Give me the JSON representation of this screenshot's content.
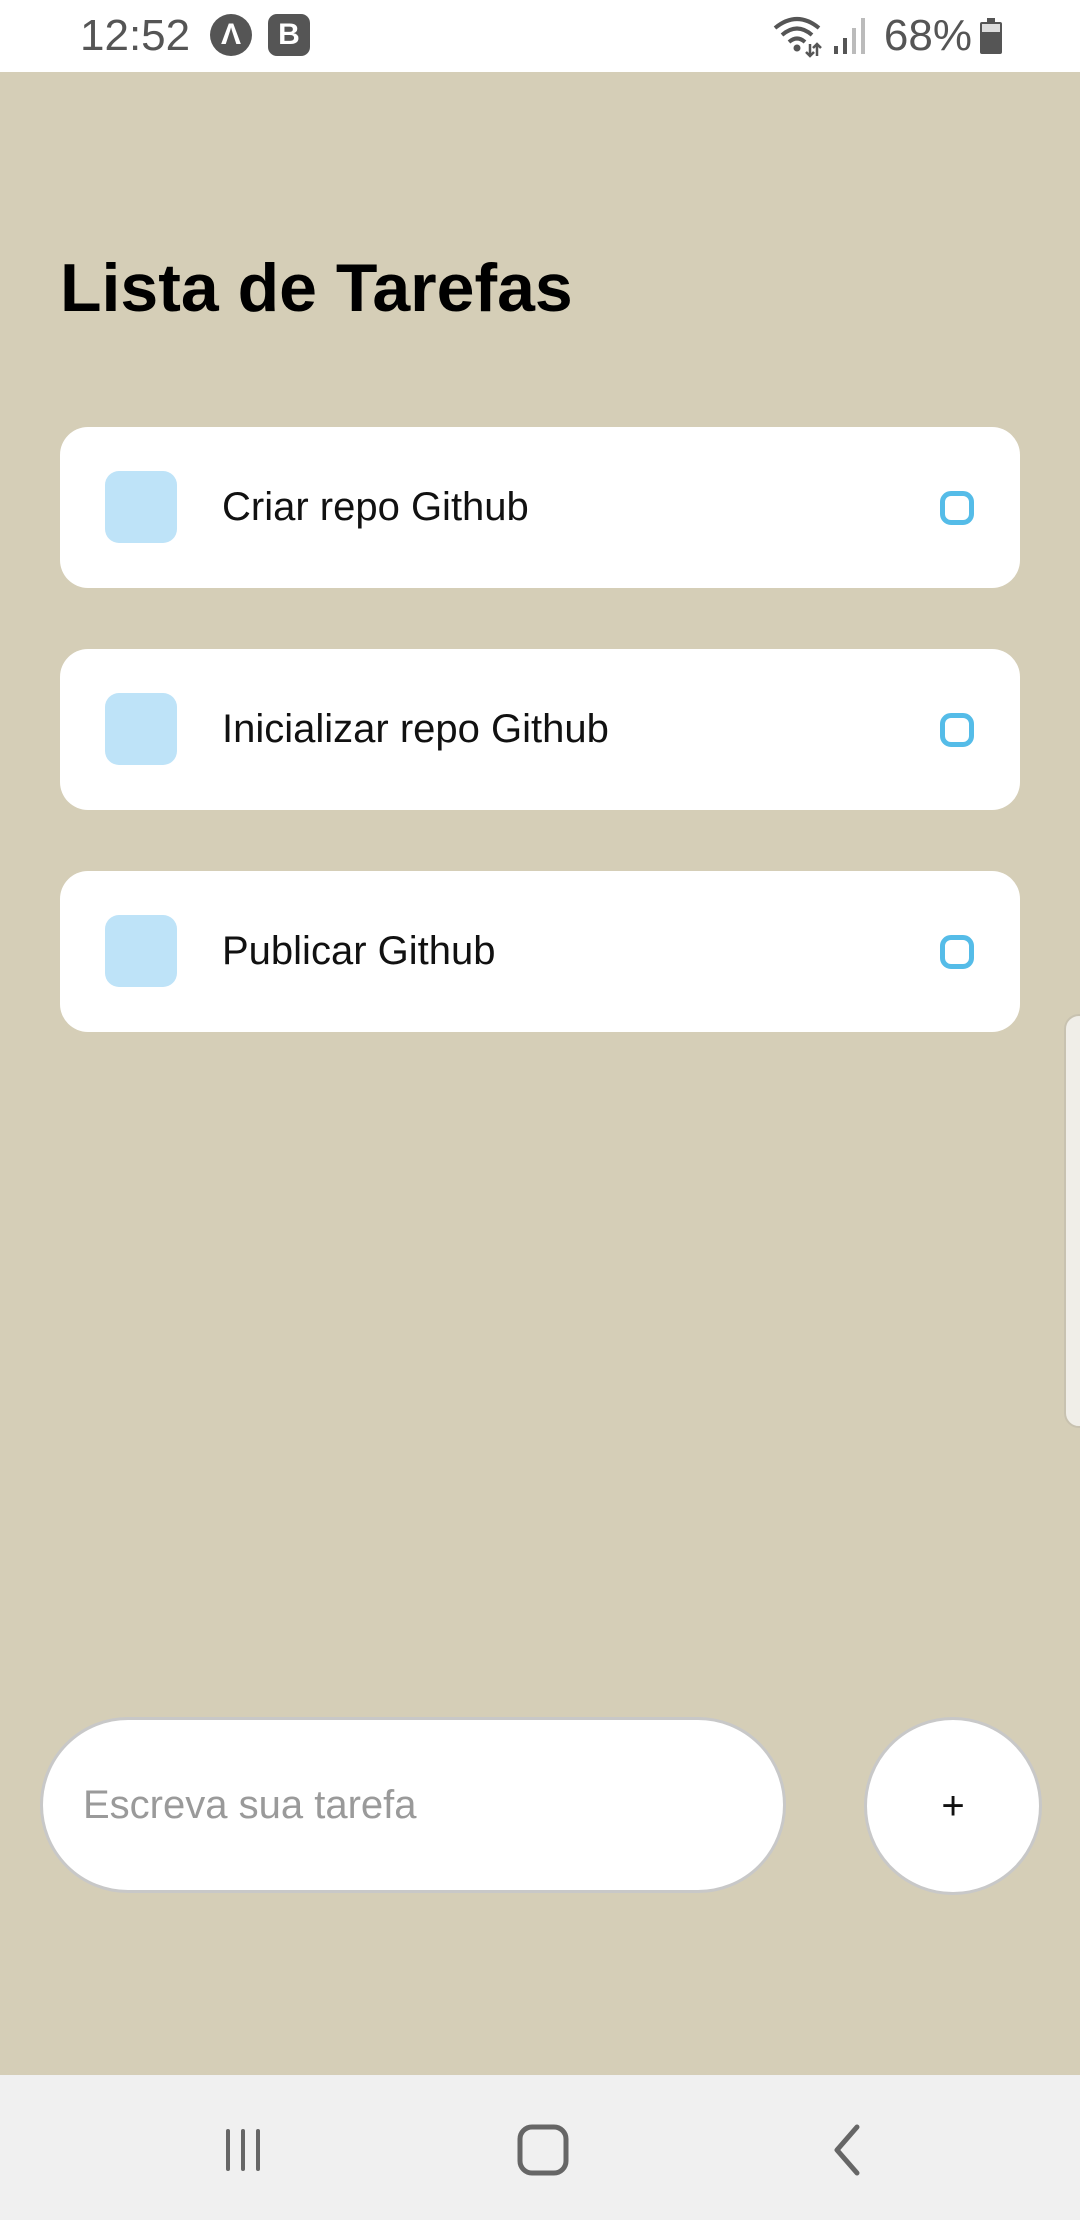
{
  "status_bar": {
    "time": "12:52",
    "notif_a": "Λ",
    "notif_b": "B",
    "battery": "68%",
    "icons": [
      "wifi-icon",
      "signal-icon",
      "battery-icon"
    ]
  },
  "title": "Lista de Tarefas",
  "tasks": [
    {
      "text": "Criar repo Github"
    },
    {
      "text": "Inicializar repo Github"
    },
    {
      "text": "Publicar Github"
    }
  ],
  "input": {
    "placeholder": "Escreva sua tarefa",
    "value": ""
  },
  "add_button": {
    "label": "+"
  },
  "nav": {
    "icons": [
      "recents-icon",
      "home-icon",
      "back-icon"
    ]
  },
  "colors": {
    "background": "#D5CEB7",
    "card": "#FFFFFF",
    "task_square": "#BEE3F8",
    "task_circle": "#55BCE8"
  }
}
